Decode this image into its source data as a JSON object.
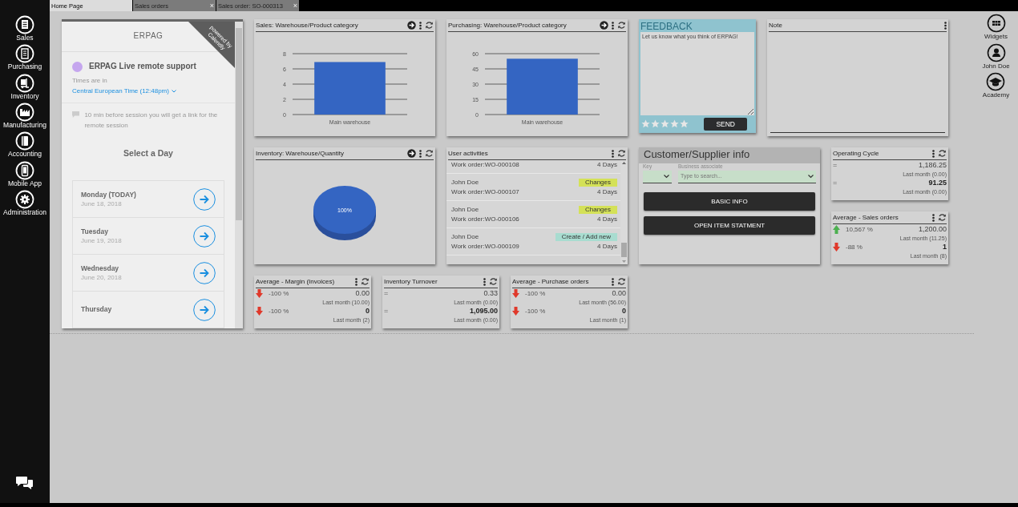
{
  "tabs": [
    {
      "label": "Home Page",
      "selected": true
    },
    {
      "label": "Sales orders",
      "selected": false,
      "close": "×"
    },
    {
      "label": "Sales order: SO-000313",
      "selected": false,
      "close": "×"
    }
  ],
  "sidebar": {
    "items": [
      {
        "label": "Sales"
      },
      {
        "label": "Purchasing"
      },
      {
        "label": "Inventory"
      },
      {
        "label": "Manufacturing"
      },
      {
        "label": "Accounting"
      },
      {
        "label": "Mobile App"
      },
      {
        "label": "Administration"
      }
    ]
  },
  "right_sidebar": {
    "items": [
      {
        "label": "Widgets"
      },
      {
        "label": "John Doe"
      },
      {
        "label": "Academy"
      }
    ]
  },
  "scheduler": {
    "brand": "ERPAG",
    "ribbon": "powered by Calendly",
    "event_title": "ERPAG Live remote support",
    "timezone_label": "Times are in",
    "timezone": "Central European Time (12:48pm)",
    "notice": "10 min before session you will get a link for the remote session",
    "heading": "Select a Day",
    "days": [
      {
        "day": "Monday (TODAY)",
        "date": "June 18, 2018"
      },
      {
        "day": "Tuesday",
        "date": "June 19, 2018"
      },
      {
        "day": "Wednesday",
        "date": "June 20, 2018"
      },
      {
        "day": "Thursday"
      }
    ]
  },
  "sales_chart": {
    "title": "Sales: Warehouse/Product category",
    "open": true,
    "menu": true,
    "refresh": true,
    "chart_data": {
      "type": "bar",
      "categories": [
        "Main warehouse"
      ],
      "values": [
        6.9
      ],
      "ylim": [
        0,
        8
      ],
      "yticks": [
        0,
        2,
        4,
        6,
        8
      ],
      "grid": true
    }
  },
  "purchasing_chart": {
    "title": "Purchasing: Warehouse/Product category",
    "open": true,
    "menu": true,
    "refresh": true,
    "chart_data": {
      "type": "bar",
      "categories": [
        "Main warehouse"
      ],
      "values": [
        55
      ],
      "ylim": [
        0,
        60
      ],
      "yticks": [
        0,
        15,
        30,
        45,
        60
      ],
      "grid": true
    }
  },
  "feedback": {
    "title": "FEEDBACK",
    "placeholder": "Let us know what you think of ERPAG!",
    "stars": 0,
    "button": "SEND"
  },
  "note": {
    "title": "Note",
    "menu": true
  },
  "inventory_chart": {
    "title": "Inventory: Warehouse/Quantity",
    "open": true,
    "menu": true,
    "refresh": true,
    "chart_data": {
      "type": "pie",
      "values": [
        100
      ],
      "value_labels": [
        "100%"
      ]
    }
  },
  "user_activities": {
    "title": "User activities",
    "menu": true,
    "refresh": true,
    "items": [
      {
        "subject": "Work order:WO-000108",
        "age": "4 Days"
      },
      {
        "user": "John Doe",
        "subject": "Work order:WO-000107",
        "action": "Changes",
        "color": "#d4e157",
        "age": "4 Days"
      },
      {
        "user": "John Doe",
        "subject": "Work order:WO-000106",
        "action": "Changes",
        "color": "#d4e157",
        "age": "4 Days"
      },
      {
        "user": "John Doe",
        "subject": "Work order:WO-000109",
        "action": "Create / Add new",
        "color": "#a8dcd0",
        "age": "4 Days"
      }
    ]
  },
  "customer_supplier": {
    "title": "Customer/Supplier info",
    "key_label": "Key",
    "associate_label": "Business associate",
    "associate_placeholder": "Type to search...",
    "buttons": [
      "BASIC INFO",
      "OPEN ITEM STATMENT"
    ]
  },
  "operating_cycle": {
    "title": "Operating Cycle",
    "menu": true,
    "refresh": true,
    "rows": [
      {
        "sign": "=",
        "value": "1,186.25",
        "last": "Last month (0.00)"
      },
      {
        "sign": "=",
        "value": "91.25",
        "last": "Last month (0.00)"
      }
    ]
  },
  "average_sales_orders": {
    "title": "Average - Sales orders",
    "menu": true,
    "refresh": true,
    "rows": [
      {
        "kind": "up",
        "percent": "10,567 %",
        "value": "1,200.00",
        "last": "Last month (11.25)"
      },
      {
        "kind": "down",
        "percent": "-88 %",
        "value": "1",
        "last": "Last month (8)"
      }
    ]
  },
  "average_margin": {
    "title": "Average - Margin (Invoices)",
    "menu": true,
    "refresh": true,
    "rows": [
      {
        "kind": "down",
        "percent": "-100 %",
        "value": "0.00",
        "last": "Last month (10.00)"
      },
      {
        "kind": "down",
        "percent": "-100 %",
        "value": "0",
        "last": "Last month (2)"
      }
    ]
  },
  "inventory_turnover": {
    "title": "Inventory Turnover",
    "menu": true,
    "refresh": true,
    "rows": [
      {
        "sign": "=",
        "value": "0.33",
        "last": "Last month (0.00)"
      },
      {
        "sign": "=",
        "value": "1,095.00",
        "last": "Last month (0.00)"
      }
    ]
  },
  "average_purchase_orders": {
    "title": "Average - Purchase orders",
    "menu": true,
    "refresh": true,
    "rows": [
      {
        "kind": "down",
        "percent": "-100 %",
        "value": "0.00",
        "last": "Last month (56.00)"
      },
      {
        "kind": "down",
        "percent": "-100 %",
        "value": "0",
        "last": "Last month (1)"
      }
    ]
  }
}
